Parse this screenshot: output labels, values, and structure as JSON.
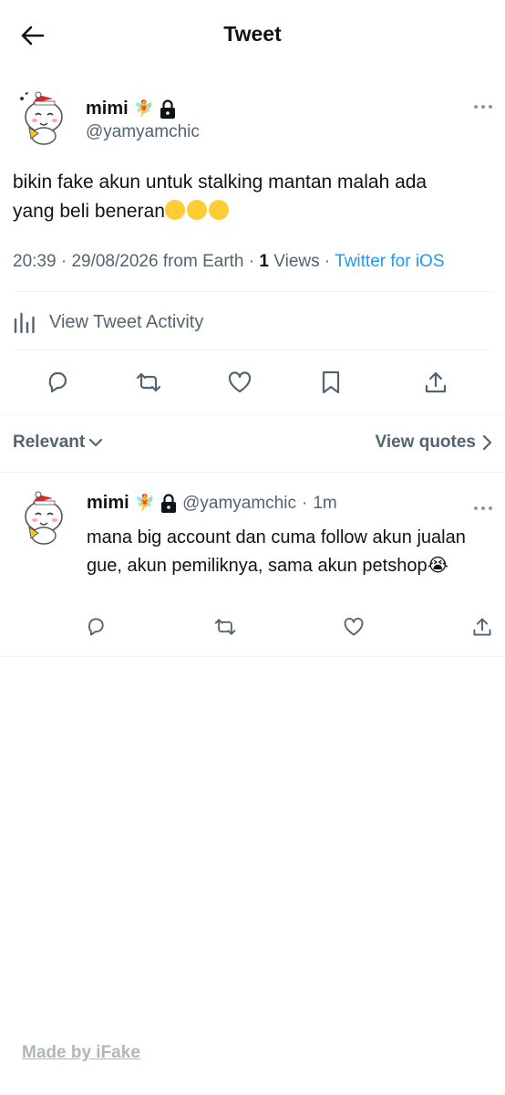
{
  "header": {
    "title": "Tweet",
    "back_icon": "arrow-left-icon"
  },
  "tweet": {
    "display_name": "mimi",
    "name_emoji": "🧚",
    "lock_icon": "lock-icon",
    "handle": "@yamyamchic",
    "text_line1": "bikin fake akun untuk stalking mantan malah ada",
    "text_line2": "yang beli beneran",
    "text_emoji_count": 3,
    "time": "20:39",
    "date": "29/08/2026",
    "location": "from Earth",
    "views_count": "1",
    "views_label": "Views",
    "source": "Twitter for iOS",
    "activity_label": "View Tweet Activity"
  },
  "filter": {
    "relevant_label": "Relevant",
    "quotes_label": "View quotes"
  },
  "reply": {
    "display_name": "mimi",
    "name_emoji": "🧚",
    "handle": "@yamyamchic",
    "time_ago": "1m",
    "text": "mana big account dan cuma follow akun jualan gue, akun pemiliknya, sama akun petshop",
    "text_emoji": "😭"
  },
  "footer": {
    "label": "Made by iFake"
  },
  "colors": {
    "text": "#0f1419",
    "secondary": "#536471",
    "accent": "#1d9bf0",
    "divider": "#eff3f4",
    "footer": "#b0b6bb"
  }
}
